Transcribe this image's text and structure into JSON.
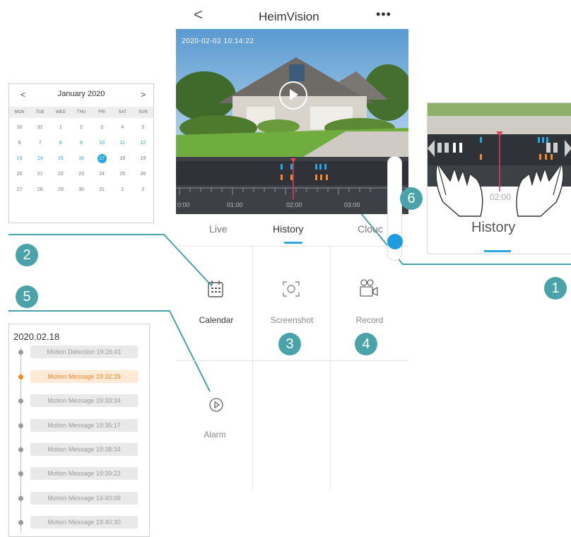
{
  "header": {
    "back_icon": "chevron-left-icon",
    "back_glyph": "<",
    "title": "HeimVision",
    "more_glyph": "•••"
  },
  "video": {
    "timestamp": "2020-02-02 10:14:22",
    "play_icon": "play-icon"
  },
  "timeline": {
    "labels": [
      "0:00",
      "01:00",
      "02:00",
      "03:00"
    ]
  },
  "tabs": [
    {
      "label": "Live"
    },
    {
      "label": "History"
    },
    {
      "label": "Clouc"
    }
  ],
  "actions": {
    "calendar_label": "Calendar",
    "screenshot_label": "Screenshot",
    "record_label": "Record",
    "alarm_label": "Alarm"
  },
  "badges": {
    "b1": "1",
    "b2": "2",
    "b3": "3",
    "b4": "4",
    "b5": "5",
    "b6": "6"
  },
  "calendar": {
    "prev": "<",
    "next": ">",
    "month": "January 2020",
    "dow": [
      "MON",
      "TUE",
      "WED",
      "THU",
      "FRI",
      "SAT",
      "SUN"
    ],
    "weeks": [
      [
        "30",
        "31",
        "1",
        "2",
        "3",
        "4",
        "5"
      ],
      [
        "6",
        "7",
        "8",
        "9",
        "10",
        "11",
        "12"
      ],
      [
        "13",
        "14",
        "15",
        "16",
        "17",
        "18",
        "19"
      ],
      [
        "20",
        "21",
        "22",
        "23",
        "24",
        "25",
        "26"
      ],
      [
        "27",
        "28",
        "29",
        "30",
        "31",
        "1",
        "2"
      ]
    ]
  },
  "alarm_list": {
    "date": "2020.02.18",
    "items": [
      {
        "text": "Motion Detection  19:26:41"
      },
      {
        "text": "Motion Message  19:32:29"
      },
      {
        "text": "Motion Message  19:33:34"
      },
      {
        "text": "Motion Message  19:35:17"
      },
      {
        "text": "Motion Message  19:38:34"
      },
      {
        "text": "Motion Message  19:39:22"
      },
      {
        "text": "Motion Message  19:40:09"
      },
      {
        "text": "Motion Message  19:40:30"
      }
    ]
  },
  "inset": {
    "time_label": "02:00",
    "history_label": "History"
  },
  "colors": {
    "accent": "#2aa6e0",
    "badge": "#4aa3a8",
    "highlight": "#f08a2c"
  }
}
